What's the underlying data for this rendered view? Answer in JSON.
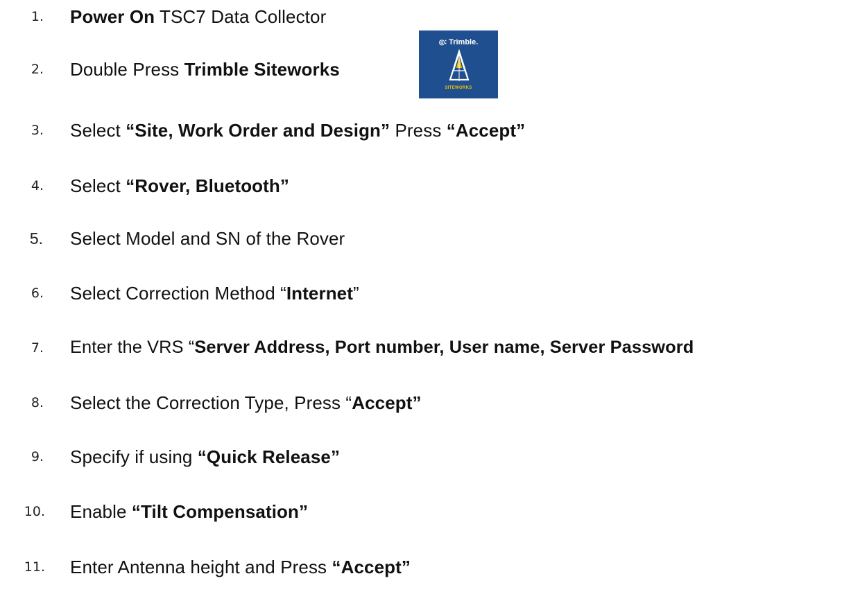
{
  "steps": [
    {
      "number": "1.",
      "parts": [
        {
          "text": "Power On",
          "bold": true
        },
        {
          "text": " TSC7 Data Collector",
          "bold": false
        }
      ]
    },
    {
      "number": "2.",
      "parts": [
        {
          "text": "Double Press ",
          "bold": false
        },
        {
          "text": "Trimble Siteworks",
          "bold": true
        }
      ]
    },
    {
      "number": "3.",
      "parts": [
        {
          "text": "Select ",
          "bold": false
        },
        {
          "text": "“Site, Work Order and Design”",
          "bold": true
        },
        {
          "text": " Press ",
          "bold": false
        },
        {
          "text": "“Accept”",
          "bold": true
        }
      ]
    },
    {
      "number": "4.",
      "parts": [
        {
          "text": "Select ",
          "bold": false
        },
        {
          "text": "“Rover, Bluetooth”",
          "bold": true
        }
      ]
    },
    {
      "number": "5.",
      "parts": [
        {
          "text": "Select Model and SN of the Rover",
          "bold": false
        }
      ]
    },
    {
      "number": "6.",
      "parts": [
        {
          "text": "Select Correction Method “",
          "bold": false
        },
        {
          "text": "Internet",
          "bold": true
        },
        {
          "text": "”",
          "bold": false
        }
      ]
    },
    {
      "number": "7.",
      "parts": [
        {
          "text": "Enter the VRS “",
          "bold": false
        },
        {
          "text": "Server Address, Port number, User name, Server Password",
          "bold": true
        }
      ]
    },
    {
      "number": "8.",
      "parts": [
        {
          "text": "Select the Correction Type, Press “",
          "bold": false
        },
        {
          "text": "Accept”",
          "bold": true
        }
      ]
    },
    {
      "number": "9.",
      "parts": [
        {
          "text": "Specify if using ",
          "bold": false
        },
        {
          "text": "“Quick Release”",
          "bold": true
        }
      ]
    },
    {
      "number": "10.",
      "parts": [
        {
          "text": "Enable ",
          "bold": false
        },
        {
          "text": "“Tilt Compensation”",
          "bold": true
        }
      ]
    },
    {
      "number": "11.",
      "parts": [
        {
          "text": "Enter Antenna height and Press ",
          "bold": false
        },
        {
          "text": "“Accept”",
          "bold": true
        }
      ]
    }
  ],
  "app_icon": {
    "brand": "Trimble.",
    "tagline": "SITEWORKS",
    "background_color": "#1f4f8e",
    "accent_color": "#f2c200",
    "icon_name": "trimble-siteworks-app-icon"
  }
}
